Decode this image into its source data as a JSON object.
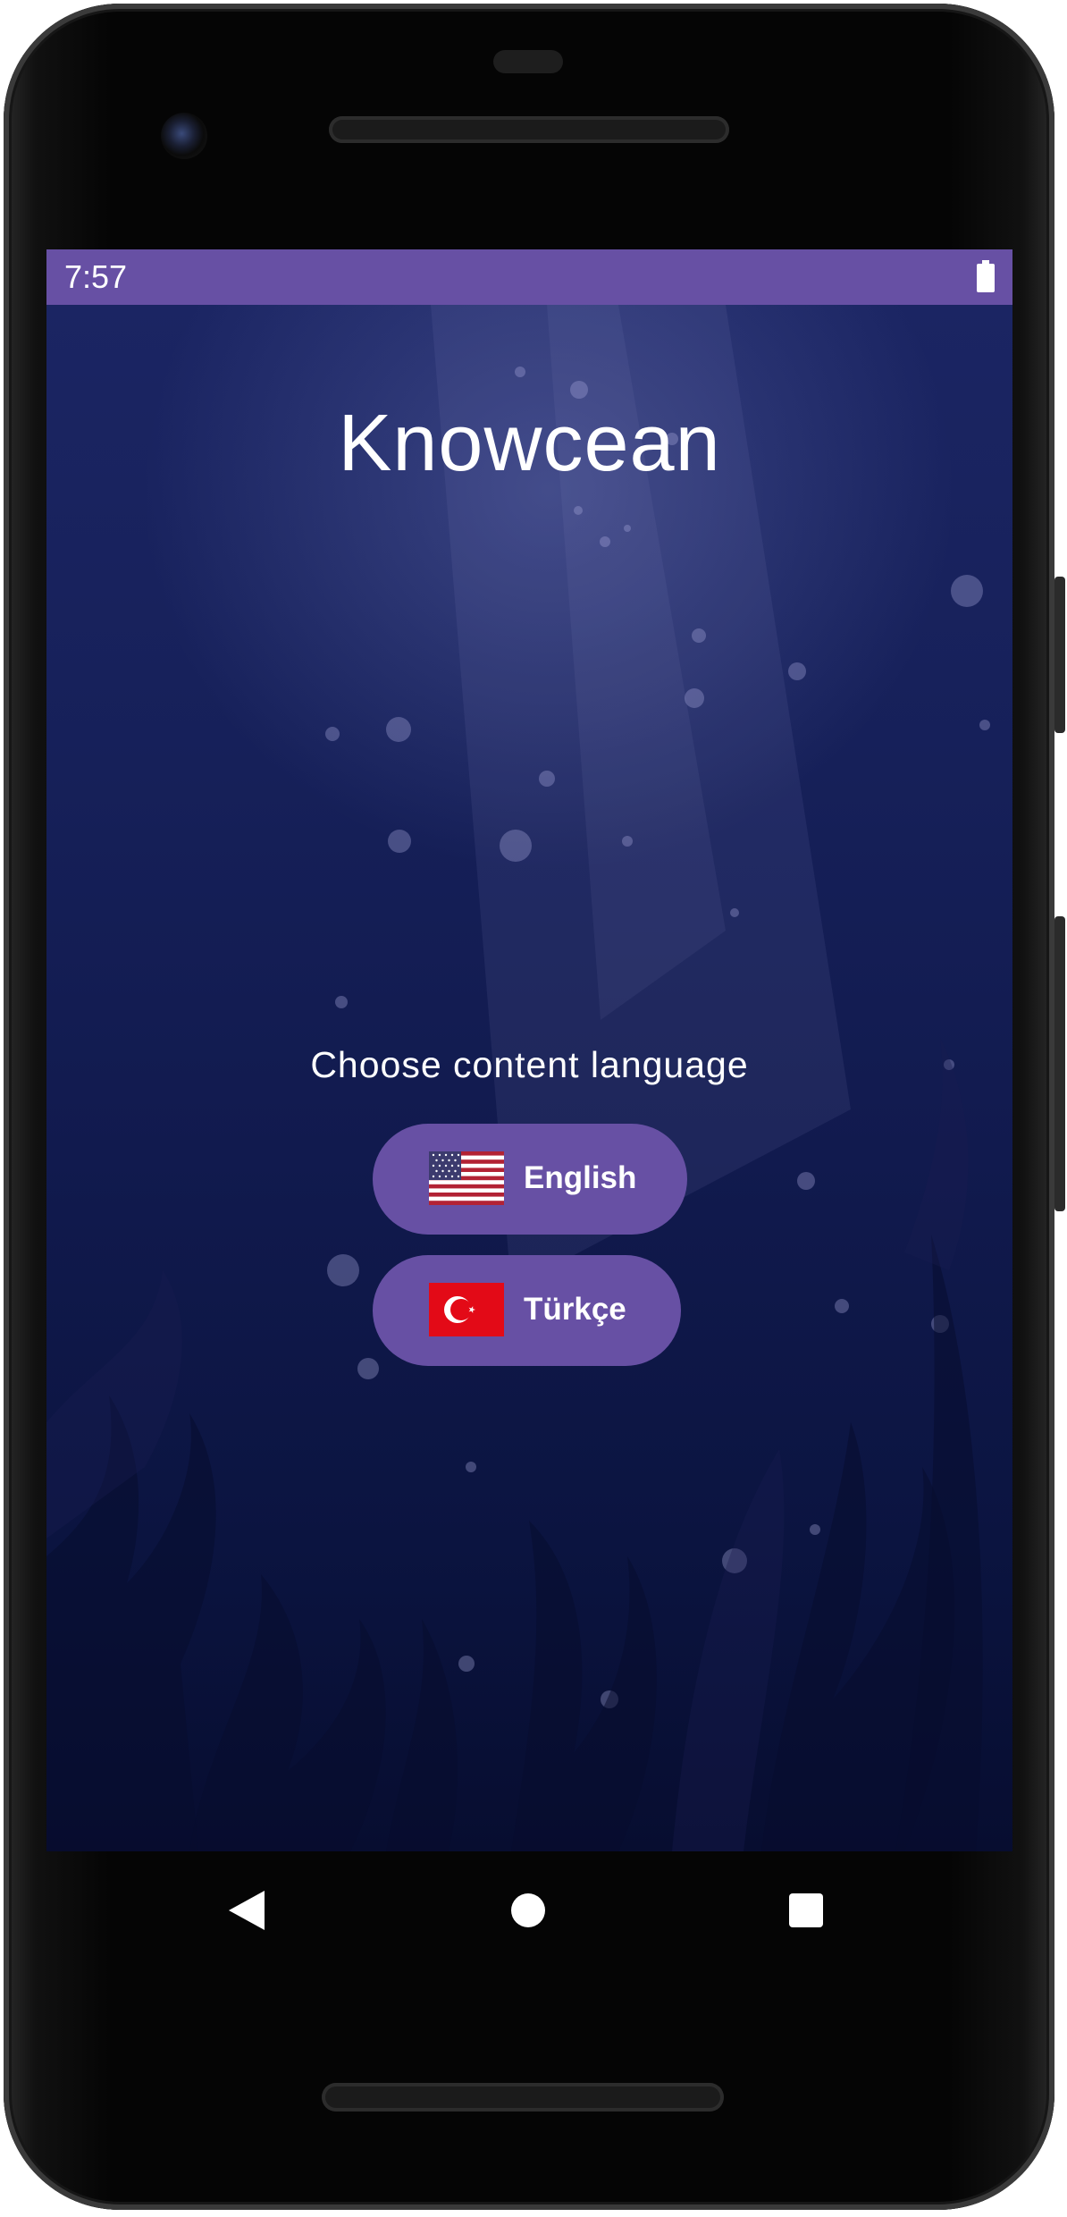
{
  "status_bar": {
    "time": "7:57",
    "battery_icon": "battery-full-icon",
    "color": "#6750a4"
  },
  "app": {
    "title": "Knowcean",
    "prompt": "Choose content language",
    "accent_color": "#6750a4",
    "background": "dark navy underwater illustration"
  },
  "languages": [
    {
      "label": "English",
      "flag_icon": "us-flag-icon"
    },
    {
      "label": "Türkçe",
      "flag_icon": "turkey-flag-icon"
    }
  ],
  "nav_bar": {
    "back_icon": "back-triangle-icon",
    "home_icon": "home-circle-icon",
    "recents_icon": "recents-square-icon"
  }
}
